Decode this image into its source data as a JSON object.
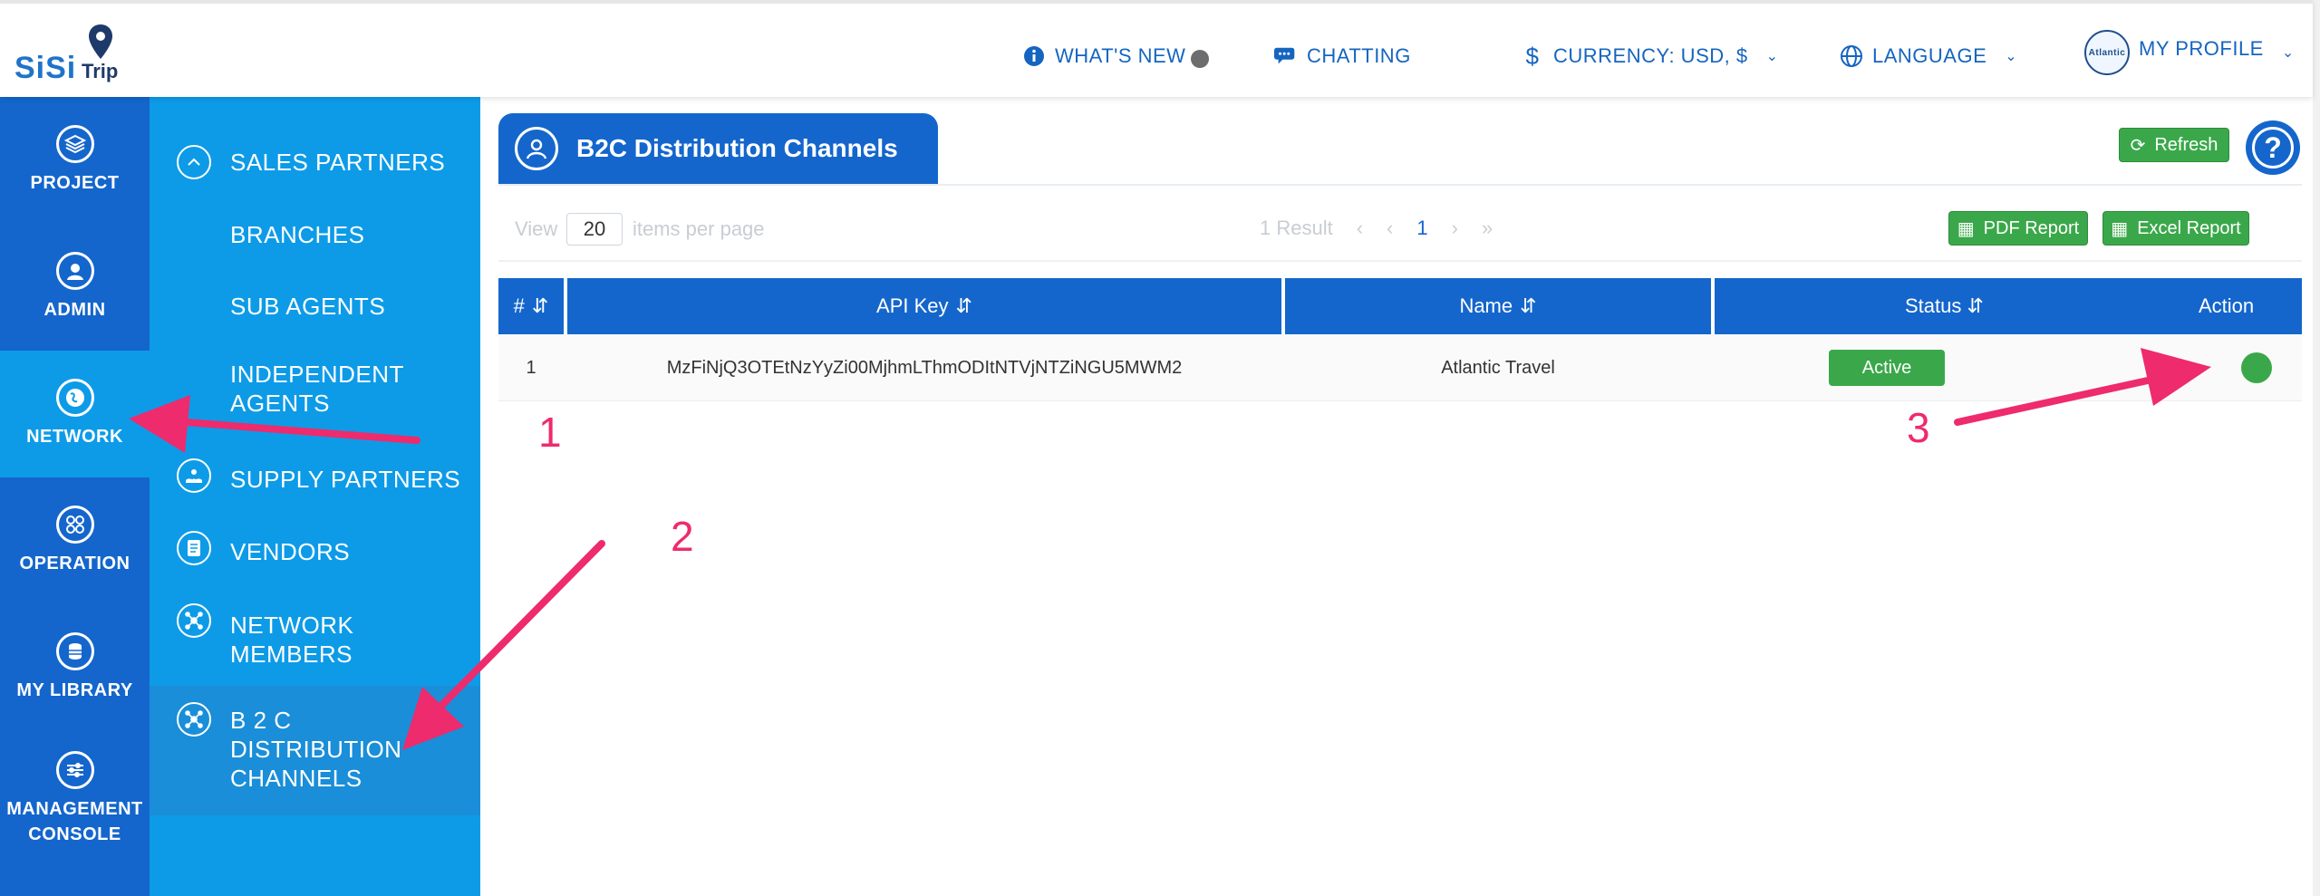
{
  "brand": {
    "name": "SiSi",
    "suffix": "Trip"
  },
  "header": {
    "whats_new": "WHAT'S NEW",
    "chatting": "CHATTING",
    "currency": "CURRENCY: USD, $",
    "language": "LANGUAGE",
    "profile": "MY PROFILE",
    "avatar_text": "Atlantic"
  },
  "rail": [
    {
      "label": "PROJECT",
      "icon": "layers-icon"
    },
    {
      "label": "ADMIN",
      "icon": "user-icon"
    },
    {
      "label": "NETWORK",
      "icon": "globe-icon",
      "active": true
    },
    {
      "label": "OPERATION",
      "icon": "grid-icon"
    },
    {
      "label": "MY LIBRARY",
      "icon": "database-icon"
    },
    {
      "label": "MANAGEMENT CONSOLE",
      "icon": "sliders-icon"
    }
  ],
  "subnav": {
    "sales_partners": "SALES PARTNERS",
    "branches": "BRANCHES",
    "sub_agents": "SUB AGENTS",
    "independent_agents": "INDEPENDENT AGENTS",
    "supply_partners": "SUPPLY PARTNERS",
    "vendors": "VENDORS",
    "network_members": "NETWORK MEMBERS",
    "b2c_channels": "B 2 C DISTRIBUTION CHANNELS"
  },
  "panel": {
    "title": "B2C Distribution Channels",
    "refresh": "Refresh",
    "help": "?"
  },
  "toolbar": {
    "view_label": "View",
    "per_page_value": "20",
    "per_page_label": "items per page",
    "result_text": "1 Result",
    "current_page": "1",
    "pdf_report": "PDF Report",
    "excel_report": "Excel Report"
  },
  "table": {
    "columns": [
      "#",
      "API Key",
      "Name",
      "Status",
      "Action"
    ],
    "rows": [
      {
        "index": "1",
        "api_key": "MzFiNjQ3OTEtNzYyZi00MjhmLThmODItNTVjNTZiNGU5MWM2",
        "name": "Atlantic Travel",
        "status": "Active"
      }
    ]
  },
  "annotations": {
    "one": "1",
    "two": "2",
    "three": "3"
  },
  "colors": {
    "primary": "#1466cc",
    "secondary": "#0d9be8",
    "success": "#3aa84a",
    "annotation": "#ee2b6c"
  }
}
